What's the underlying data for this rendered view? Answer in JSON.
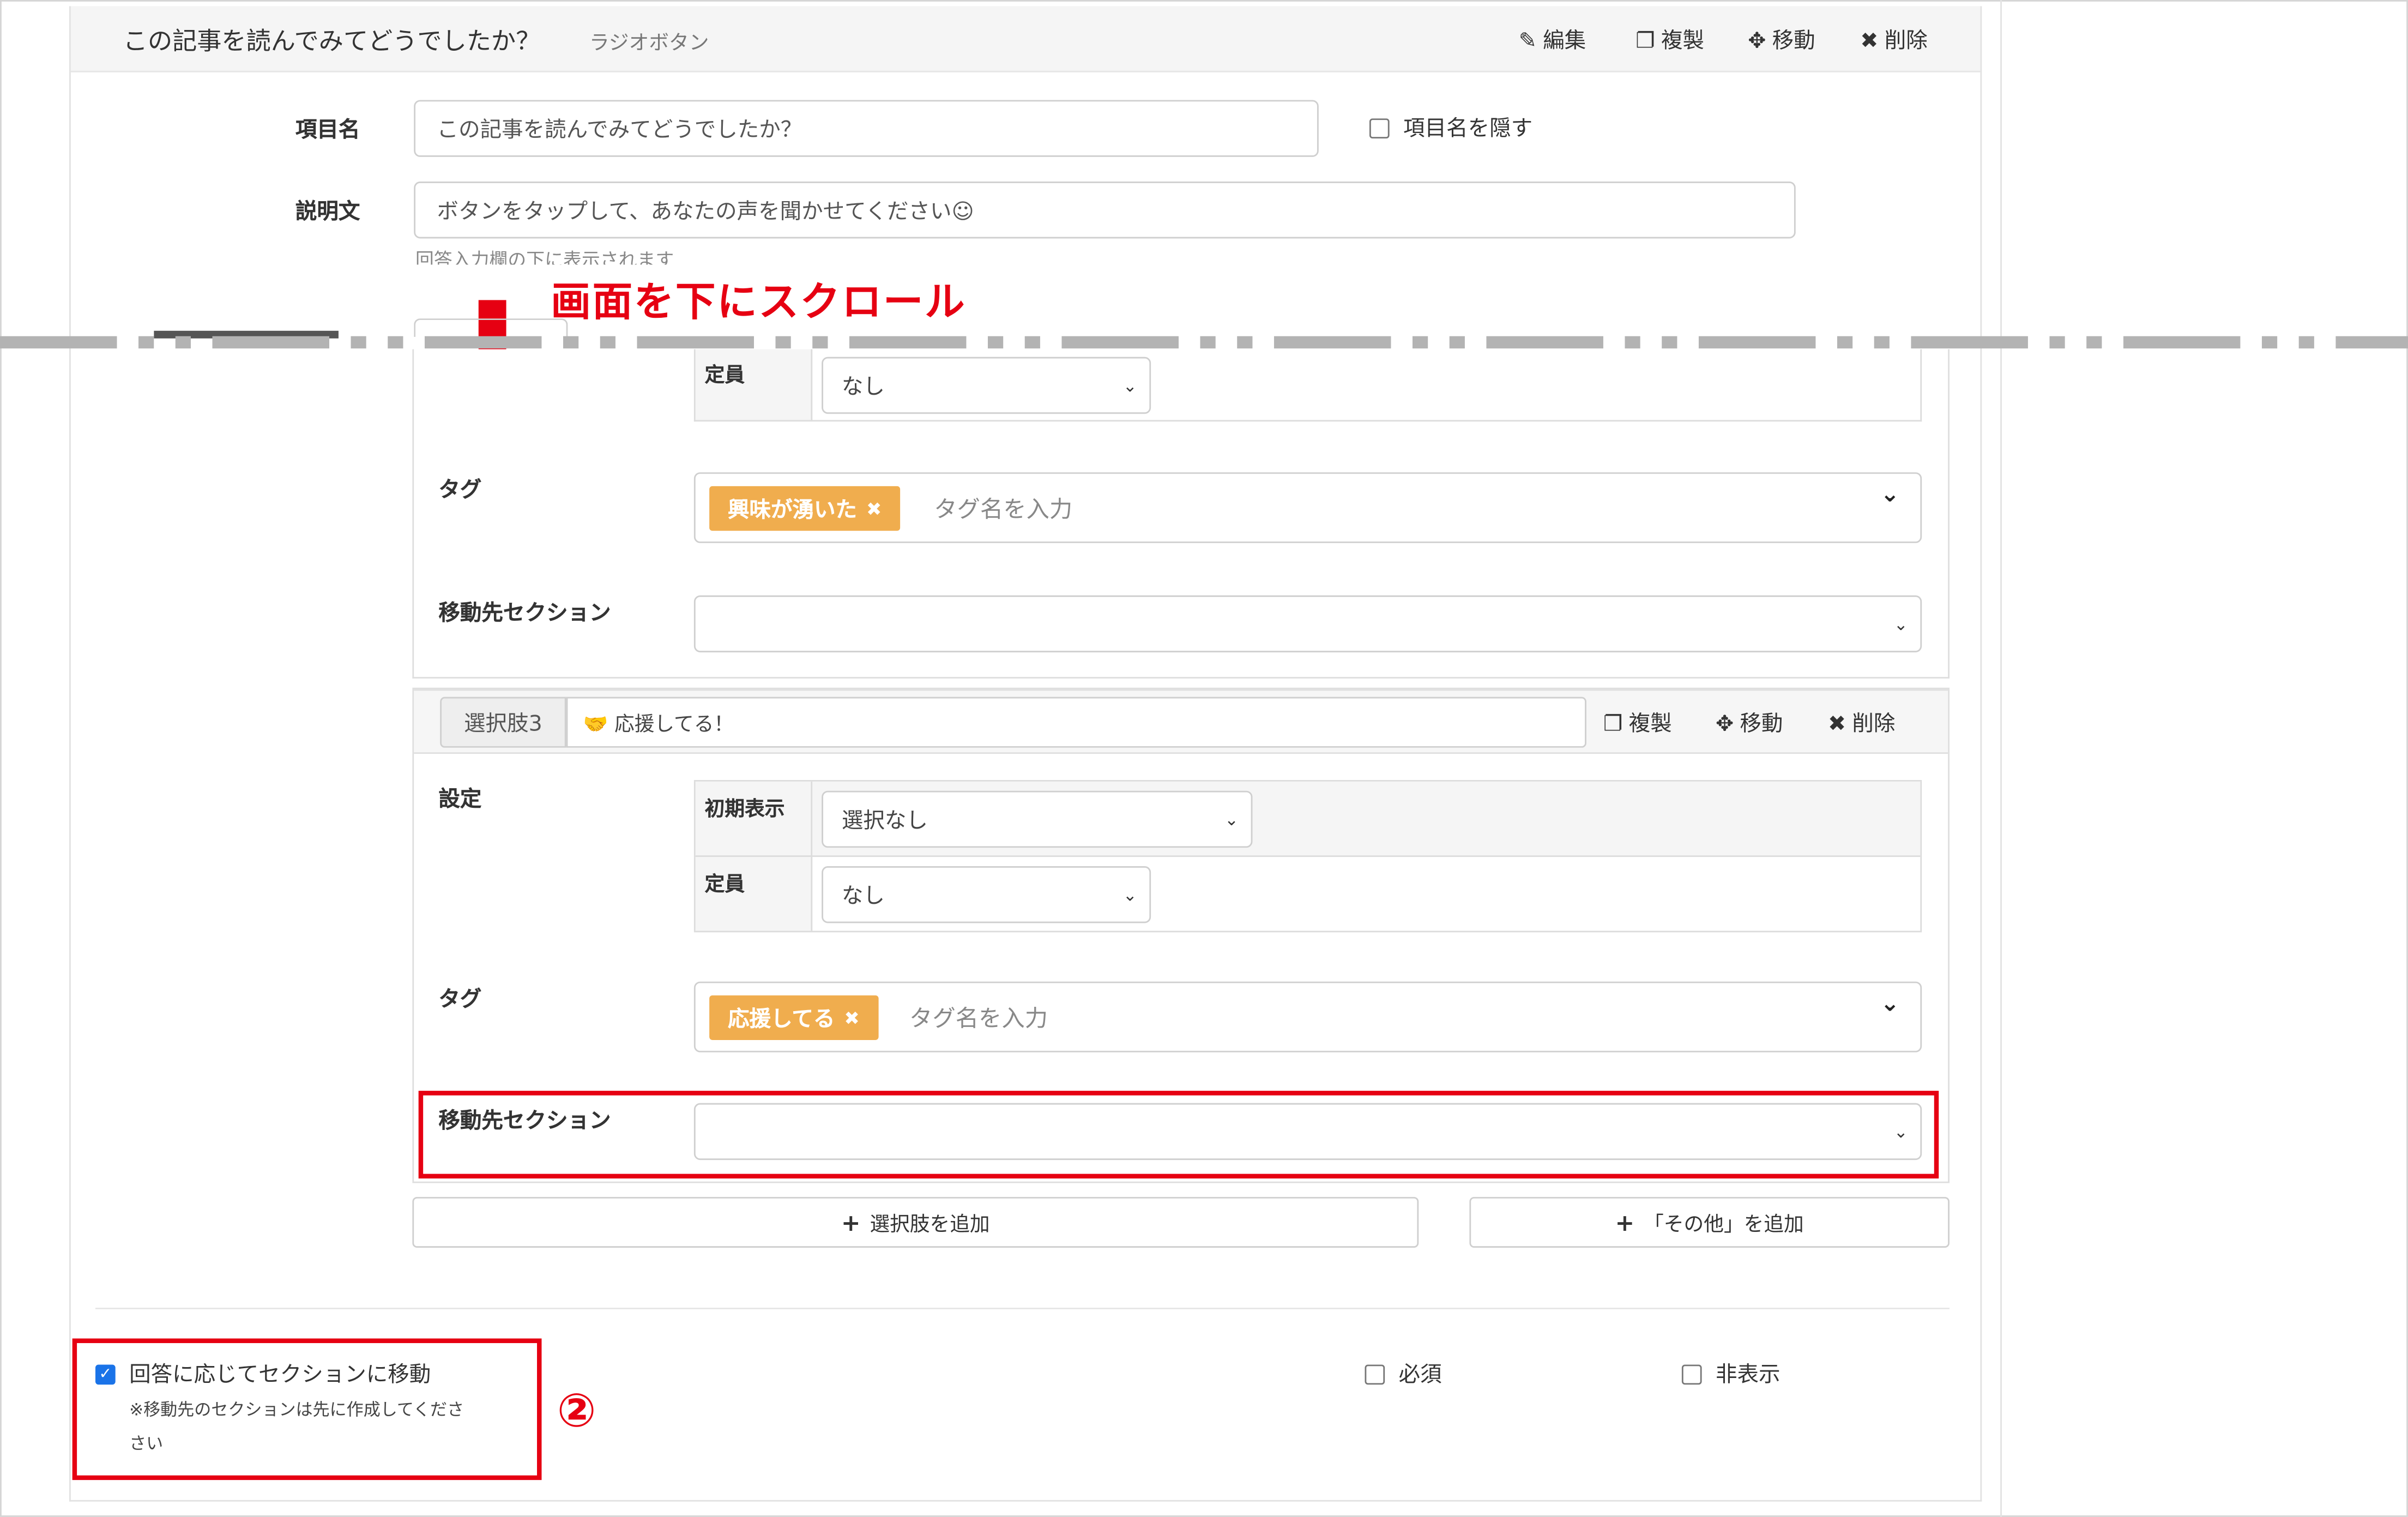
{
  "header": {
    "title": "この記事を読んでみてどうでしたか？",
    "type": "ラジオボタン",
    "actions": {
      "edit": "編集",
      "duplicate": "複製",
      "move": "移動",
      "delete": "削除"
    }
  },
  "item_name": {
    "label": "項目名",
    "value": "この記事を読んでみてどうでしたか？",
    "hide_label": "項目名を隠す"
  },
  "description": {
    "label": "説明文",
    "value": "ボタンをタップして、あなたの声を聞かせてください☺",
    "help": "回答入力欄の下に表示されます"
  },
  "annotation": {
    "scroll_text": "画面を下にスクロール",
    "number": "②"
  },
  "choice2": {
    "capacity_label": "定員",
    "capacity_value": "なし",
    "tag_label": "タグ",
    "tag_chip": "興味が湧いた",
    "tag_placeholder": "タグ名を入力",
    "section_label": "移動先セクション",
    "section_value": ""
  },
  "choice3": {
    "badge": "選択肢3",
    "value": "🤝 応援してる！",
    "actions": {
      "duplicate": "複製",
      "move": "移動",
      "delete": "削除"
    },
    "settings_label": "設定",
    "initial_label": "初期表示",
    "initial_value": "選択なし",
    "capacity_label": "定員",
    "capacity_value": "なし",
    "tag_label": "タグ",
    "tag_chip": "応援してる",
    "tag_placeholder": "タグ名を入力",
    "section_label": "移動先セクション",
    "section_value": ""
  },
  "buttons": {
    "add_choice": "選択肢を追加",
    "add_other": "「その他」を追加"
  },
  "footer": {
    "move_by_answer": "回答に応じてセクションに移動",
    "move_note_1": "※移動先のセクションは先に作成してくださ",
    "move_note_2": "さい",
    "required": "必須",
    "hidden": "非表示"
  },
  "colors": {
    "annotation_red": "#e60012",
    "tag_orange": "#f0ad4e",
    "checkbox_blue": "#1a73e8"
  },
  "icons": [
    "pencil-icon",
    "duplicate-icon",
    "move-icon",
    "delete-icon",
    "plus-icon",
    "chevron-down-icon",
    "down-arrow-icon"
  ]
}
